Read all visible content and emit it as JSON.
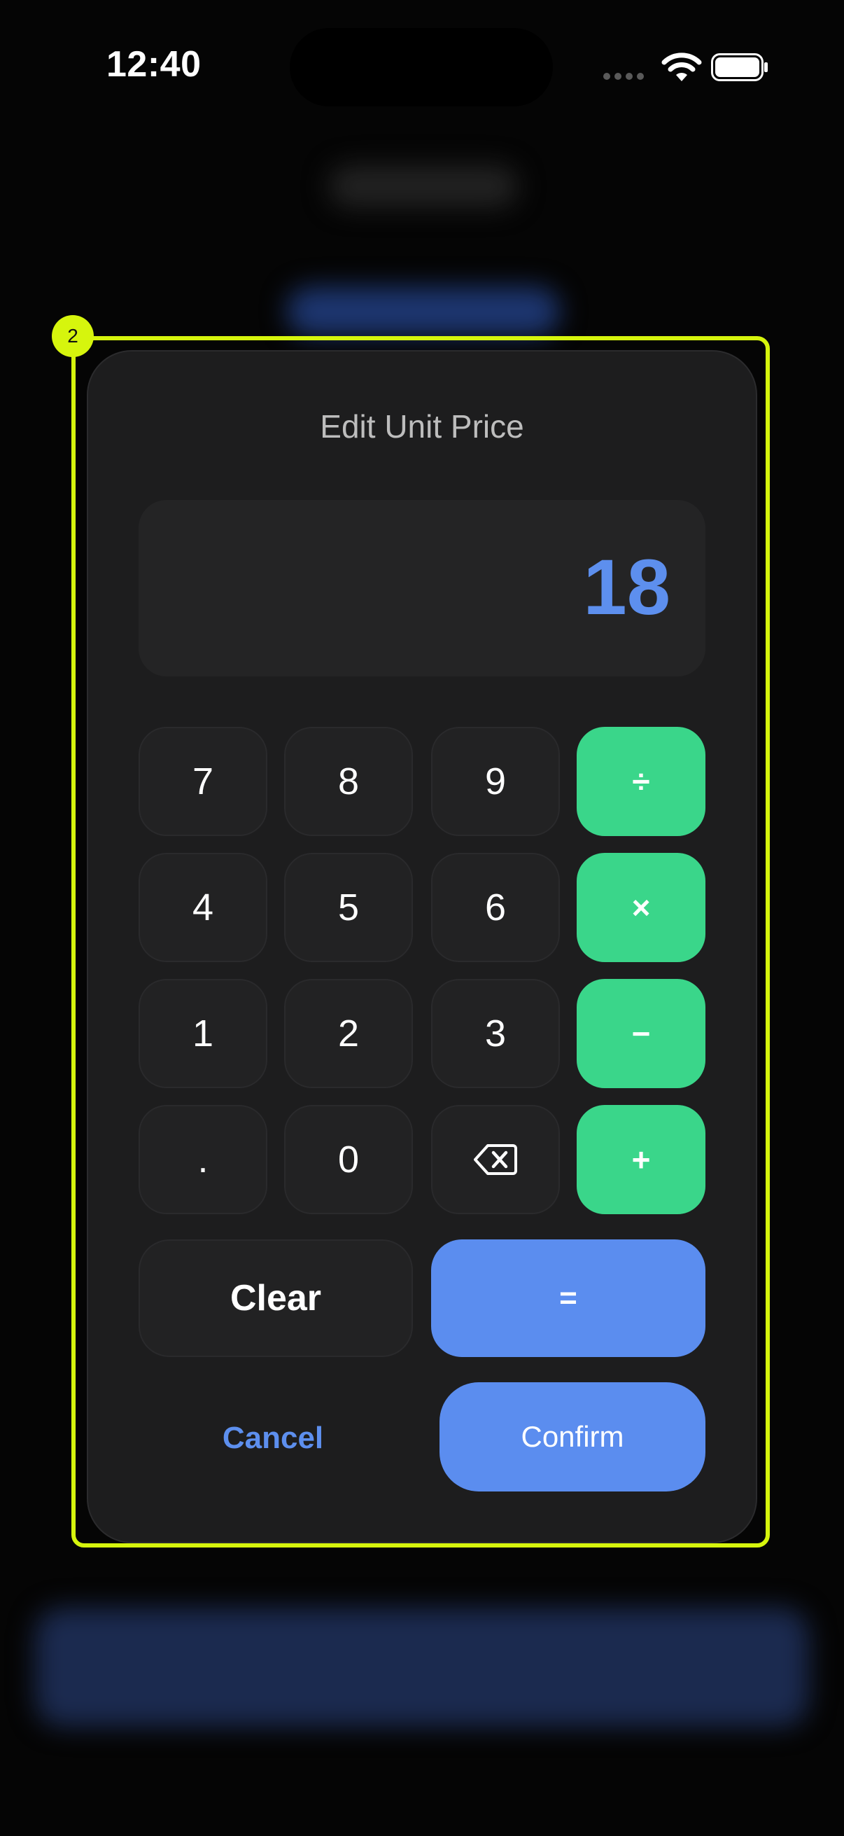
{
  "status_bar": {
    "time": "12:40"
  },
  "overlay": {
    "badge": "2"
  },
  "dialog": {
    "title": "Edit Unit Price",
    "display_value": "18",
    "keys": {
      "k7": "7",
      "k8": "8",
      "k9": "9",
      "div": "÷",
      "k4": "4",
      "k5": "5",
      "k6": "6",
      "mul": "×",
      "k1": "1",
      "k2": "2",
      "k3": "3",
      "sub": "−",
      "dot": ".",
      "k0": "0",
      "add": "+"
    },
    "backspace_icon": "backspace-icon",
    "clear_label": "Clear",
    "equals_label": "=",
    "cancel_label": "Cancel",
    "confirm_label": "Confirm"
  },
  "colors": {
    "accent_blue": "#5b8def",
    "operator_green": "#3ad68a",
    "highlight": "#d6f50d"
  }
}
